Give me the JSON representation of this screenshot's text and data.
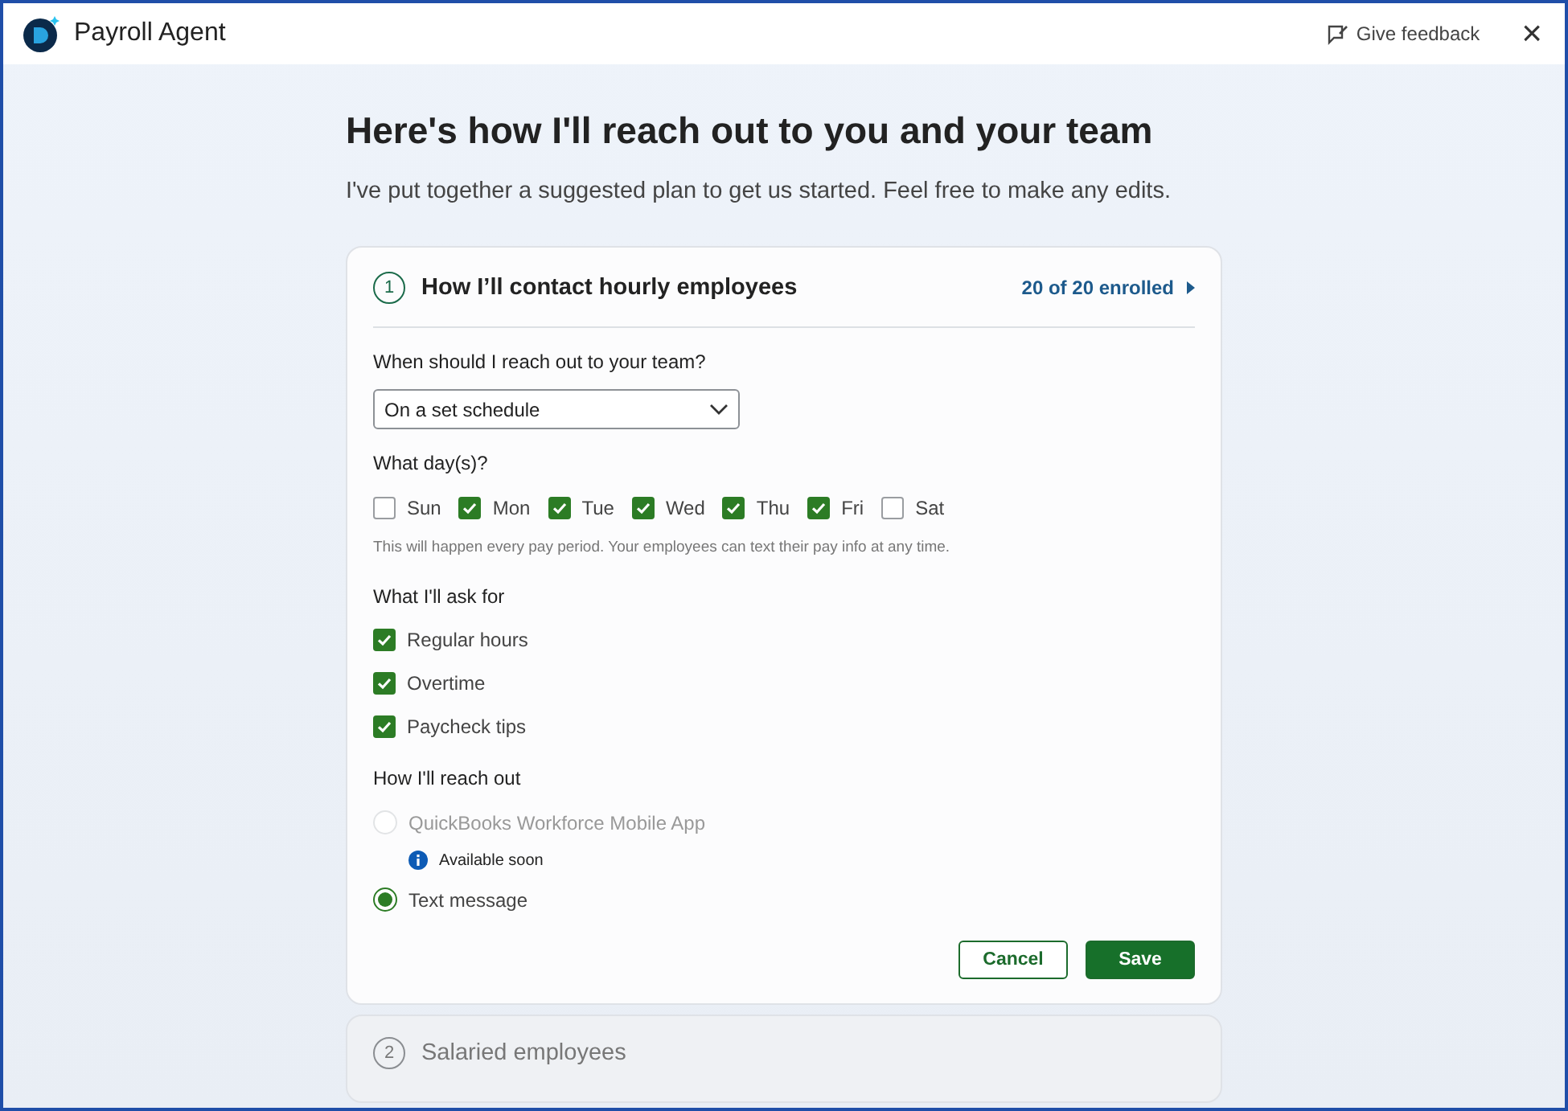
{
  "header": {
    "title": "Payroll Agent",
    "feedback": "Give feedback",
    "close": "×"
  },
  "heading": "Here's how I'll reach out to you and your team",
  "subheading": "I've put together a suggested plan to get us started. Feel free to make any edits.",
  "steps": [
    {
      "number": "1",
      "title": "How I’ll contact hourly employees",
      "active": true,
      "enrolled": "20 of 20 enrolled",
      "schedule_label": "When should I reach out to your team?",
      "schedule_value": "On a set schedule",
      "days_label": "What day(s)?",
      "days": [
        {
          "label": "Sun",
          "checked": false
        },
        {
          "label": "Mon",
          "checked": true
        },
        {
          "label": "Tue",
          "checked": true
        },
        {
          "label": "Wed",
          "checked": true
        },
        {
          "label": "Thu",
          "checked": true
        },
        {
          "label": "Fri",
          "checked": true
        },
        {
          "label": "Sat",
          "checked": false
        }
      ],
      "days_note": "This will happen every pay period. Your employees can text their pay info at any time.",
      "ask_label": "What I'll ask for",
      "ask": [
        {
          "label": "Regular hours",
          "checked": true
        },
        {
          "label": "Overtime",
          "checked": true
        },
        {
          "label": "Paycheck tips",
          "checked": true
        }
      ],
      "reach_label": "How I'll reach out",
      "reach": [
        {
          "label": "QuickBooks Workforce Mobile App",
          "selected": false,
          "disabled": true,
          "note": "Available soon"
        },
        {
          "label": "Text message",
          "selected": true,
          "disabled": false
        }
      ],
      "buttons": {
        "cancel": "Cancel",
        "save": "Save"
      }
    },
    {
      "number": "2",
      "title": "Salaried employees",
      "active": false
    }
  ]
}
